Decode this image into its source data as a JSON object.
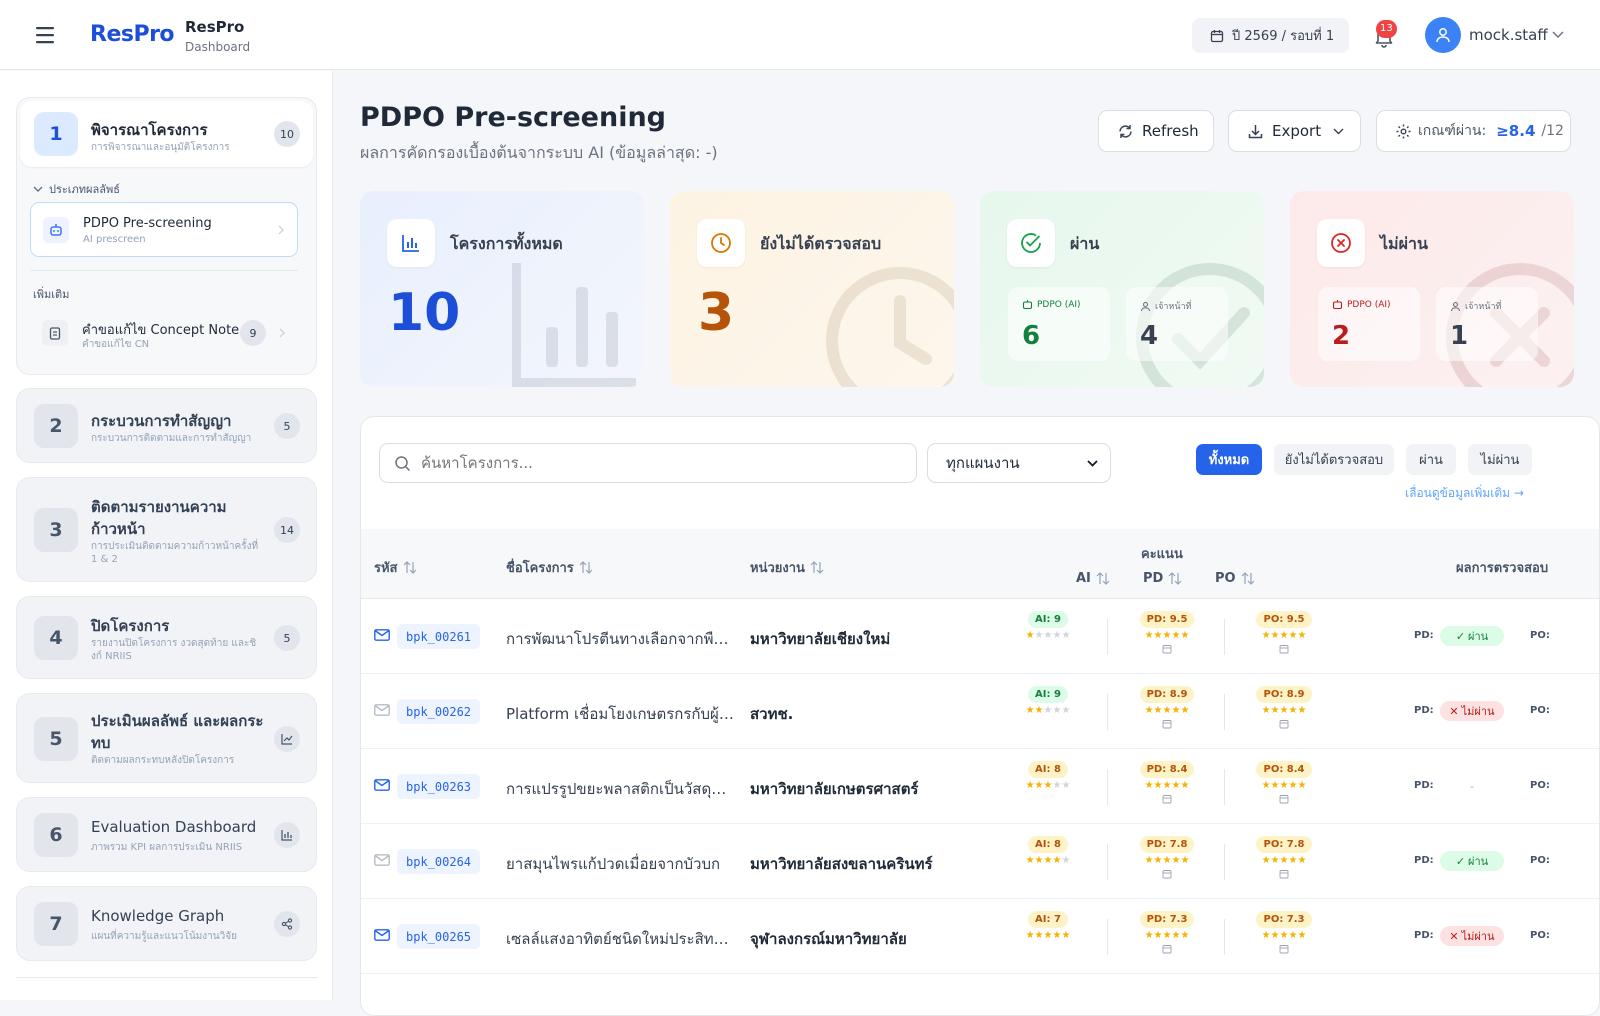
{
  "header": {
    "logo": "ResPro",
    "app_title": "ResPro",
    "app_subtitle": "Dashboard",
    "year_round": "ปี 2569 / รอบที่ 1",
    "notifications": "13",
    "username": "mock.staff"
  },
  "sidebar": {
    "groups": [
      {
        "num": "1",
        "title": "พิจารณาโครงการ",
        "subtitle": "การพิจารณาและอนุมัติโครงการ",
        "count": "10"
      },
      {
        "num": "2",
        "title": "กระบวนการทำสัญญา",
        "subtitle": "กระบวนการติดตามและการทำสัญญา",
        "count": "5"
      },
      {
        "num": "3",
        "title": "ติดตามรายงานความก้าวหน้า",
        "subtitle": "การประเมินติดตามความก้าวหน้าครั้งที่ 1 & 2",
        "count": "14"
      },
      {
        "num": "4",
        "title": "ปิดโครงการ",
        "subtitle": "รายงานปิดโครงการ งวดสุดท้าย และชิงก์ NRIIS",
        "count": "5"
      },
      {
        "num": "5",
        "title": "ประเมินผลลัพธ์ และผลกระทบ",
        "subtitle": "ติดตามผลกระทบหลังปิดโครงการ",
        "icon": "line-chart-icon"
      },
      {
        "num": "6",
        "title": "Evaluation Dashboard",
        "subtitle": "ภาพรวม KPI ผลการประเมิน NRIIS",
        "icon": "bar-chart-icon"
      },
      {
        "num": "7",
        "title": "Knowledge Graph",
        "subtitle": "แผนที่ความรู้และแนวโน้มงานวิจัย",
        "icon": "share-icon"
      }
    ],
    "section_label": "ประเภทผลลัพธ์",
    "active_item": {
      "title": "PDPO Pre-screening",
      "subtitle": "AI prescreen"
    },
    "more_label": "เพิ่มเติม",
    "more_item": {
      "title": "คำขอแก้ไข Concept Note",
      "subtitle": "คำขอแก้ไข CN",
      "count": "9"
    }
  },
  "page": {
    "title": "PDPO Pre-screening",
    "subtitle": "ผลการคัดกรองเบื้องต้นจากระบบ AI (ข้อมูลล่าสุด: -)",
    "refresh_label": "Refresh",
    "export_label": "Export",
    "threshold_label": "เกณฑ์ผ่าน:",
    "threshold_value": "≥8.4",
    "threshold_max": "/12"
  },
  "stats": {
    "total": {
      "label": "โครงการทั้งหมด",
      "value": "10",
      "color": "#1d4ed8"
    },
    "pending": {
      "label": "ยังไม่ได้ตรวจสอบ",
      "value": "3",
      "color": "#b45309"
    },
    "pass": {
      "label": "ผ่าน",
      "ai_label": "PDPO (AI)",
      "ai_value": "6",
      "staff_label": "เจ้าหน้าที่",
      "staff_value": "4",
      "color": "#15803d"
    },
    "fail": {
      "label": "ไม่ผ่าน",
      "ai_label": "PDPO (AI)",
      "ai_value": "2",
      "staff_label": "เจ้าหน้าที่",
      "staff_value": "1",
      "color": "#b91c1c"
    }
  },
  "filters": {
    "search_placeholder": "ค้นหาโครงการ...",
    "dept_selected": "ทุกแผนงาน",
    "tabs": [
      "ทั้งหมด",
      "ยังไม่ได้ตรวจสอบ",
      "ผ่าน",
      "ไม่ผ่าน"
    ],
    "scroll_hint": "เลื่อนดูข้อมูลเพิ่มเติม →"
  },
  "table": {
    "headers": {
      "code": "รหัส",
      "name": "ชื่อโครงการ",
      "agency": "หน่วยงาน",
      "score_group": "คะแนน",
      "ai": "AI",
      "pd": "PD",
      "po": "PO",
      "result": "ผลการตรวจสอบ"
    },
    "rows": [
      {
        "code": "bpk_00261",
        "name": "การพัฒนาโปรตีนทางเลือกจากพืชและแมลงสำหรับอนาคต",
        "agency": "มหาวิทยาลัยเชียงใหม่",
        "ai": "AI: 9",
        "ai_stars": 1,
        "pd": "PD: 9.5",
        "po": "PO: 9.5",
        "result": "ผ่าน",
        "status": "pass",
        "mail": "active"
      },
      {
        "code": "bpk_00262",
        "name": "Platform เชื่อมโยงเกษตรกรกับผู้ซื้อ",
        "agency": "สวทช.",
        "ai": "AI: 9",
        "ai_stars": 2,
        "pd": "PD: 8.9",
        "po": "PO: 8.9",
        "result": "ไม่ผ่าน",
        "status": "fail",
        "mail": "muted"
      },
      {
        "code": "bpk_00263",
        "name": "การแปรรูปขยะพลาสติกเป็นวัสดุก่อสร้าง",
        "agency": "มหาวิทยาลัยเกษตรศาสตร์",
        "ai": "AI: 8",
        "ai_stars": 3,
        "pd": "PD: 8.4",
        "po": "PO: 8.4",
        "result": "-",
        "status": "none",
        "mail": "active"
      },
      {
        "code": "bpk_00264",
        "name": "ยาสมุนไพรแก้ปวดเมื่อยจากบัวบก",
        "agency": "มหาวิทยาลัยสงขลานครินทร์",
        "ai": "AI: 8",
        "ai_stars": 4,
        "pd": "PD: 7.8",
        "po": "PO: 7.8",
        "result": "ผ่าน",
        "status": "pass",
        "mail": "muted"
      },
      {
        "code": "bpk_00265",
        "name": "เซลล์แสงอาทิตย์ชนิดใหม่ประสิทธิภาพสูง",
        "agency": "จุฬาลงกรณ์มหาวิทยาลัย",
        "ai": "AI: 7",
        "ai_stars": 5,
        "pd": "PD: 7.3",
        "po": "PO: 7.3",
        "result": "ไม่ผ่าน",
        "status": "fail",
        "mail": "active"
      }
    ],
    "pd_prefix": "PD:",
    "po_prefix": "PO:"
  },
  "colors": {
    "accent": "#2563eb",
    "pass": "#15803d",
    "fail": "#b91c1c",
    "pending": "#b45309"
  }
}
